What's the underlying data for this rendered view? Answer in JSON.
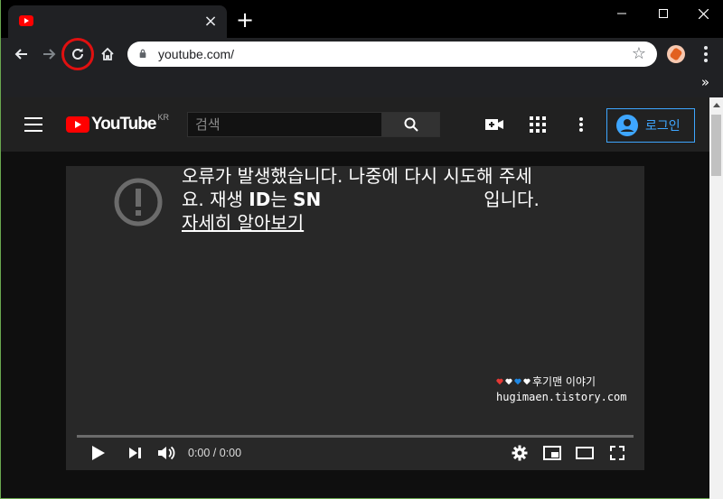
{
  "browser": {
    "tab_close": "×",
    "new_tab": "+",
    "url": "youtube.com/",
    "bookmarks_overflow": "»"
  },
  "youtube": {
    "logo_text": "YouTube",
    "region": "KR",
    "search_placeholder": "검색",
    "signin_label": "로그인"
  },
  "player": {
    "error_line1": "오류가 발생했습니다. 나중에 다시 시도해 주세",
    "error_line2_prefix": "요. 재생 ",
    "error_id_label": "ID",
    "error_line2_mid": "는 ",
    "error_id_value": "SN",
    "error_line2_suffix": "입니다.",
    "learn_more": "자세히 알아보기",
    "watermark_title": "후기맨 이야기",
    "watermark_url": "hugimaen.tistory.com",
    "time": "0:00 / 0:00",
    "progress": 0
  },
  "colors": {
    "youtube_red": "#ff0000",
    "signin_blue": "#3ea6ff",
    "highlight_ring": "#e01010"
  }
}
